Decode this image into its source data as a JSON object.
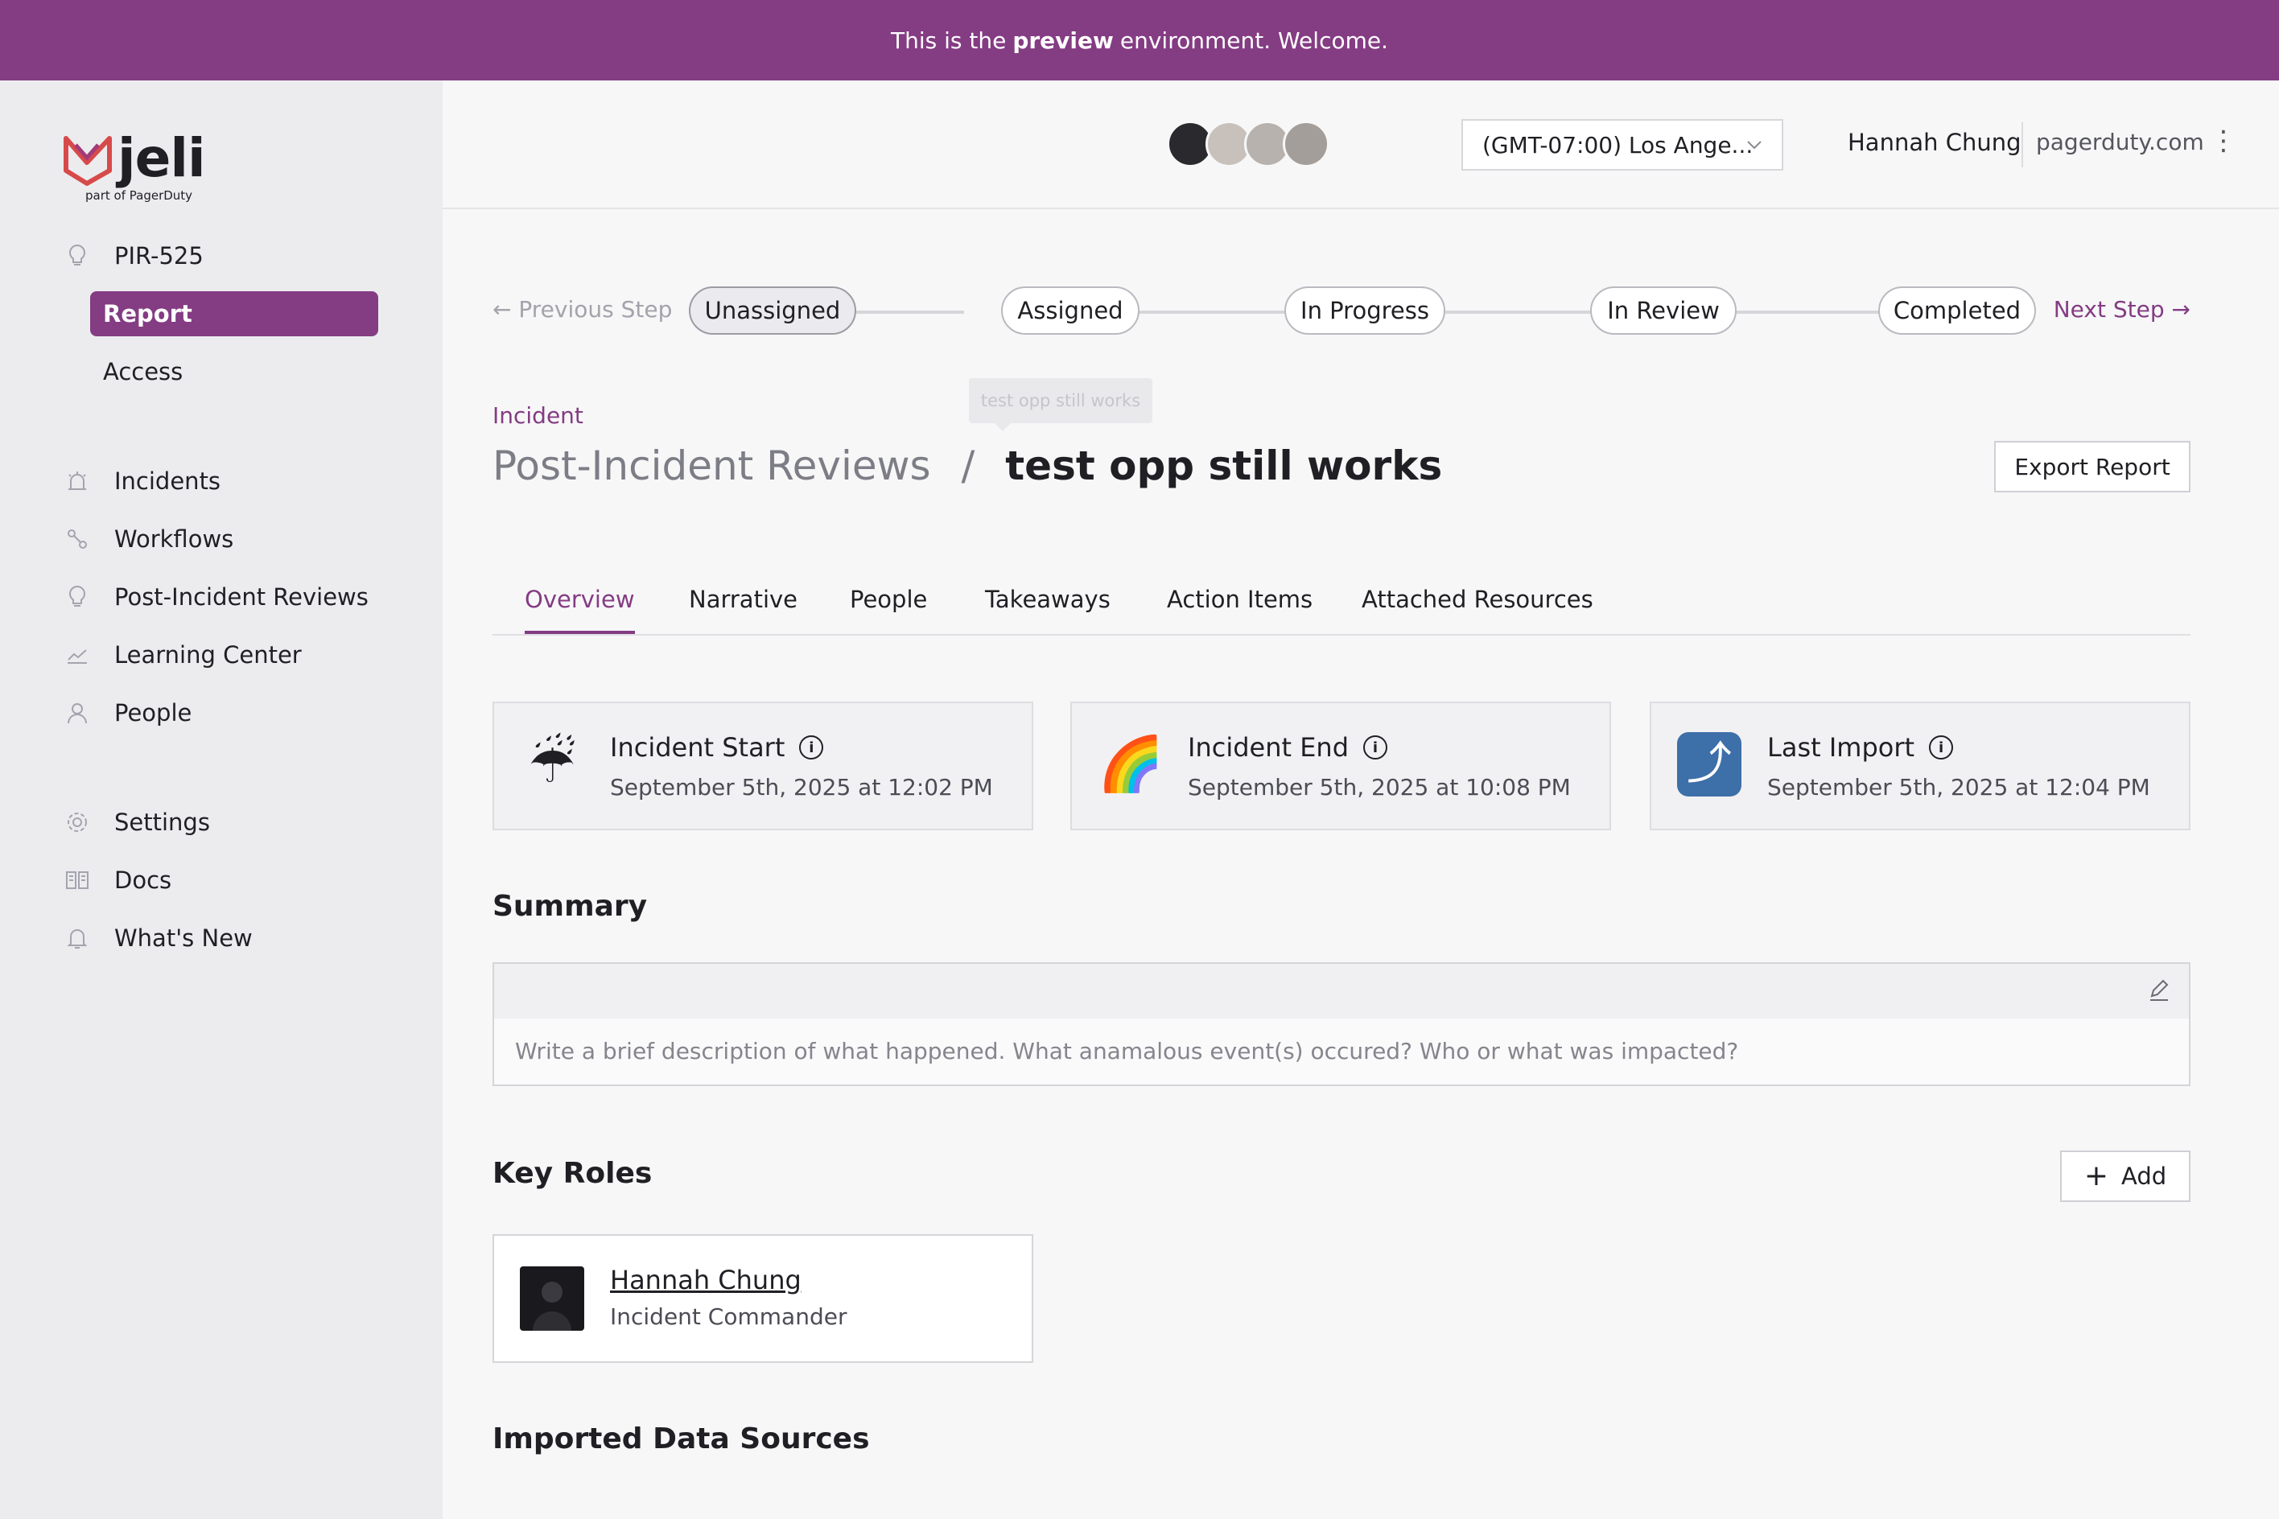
{
  "banner": {
    "prefix": "This is the",
    "bold": "preview",
    "suffix": "environment. Welcome."
  },
  "logo": {
    "name": "jeli",
    "sub": "part of PagerDuty"
  },
  "sidebar": {
    "pir_id": "PIR-525",
    "sub_items": [
      {
        "label": "Report",
        "active": true
      },
      {
        "label": "Access",
        "active": false
      }
    ],
    "main_items": [
      {
        "label": "Incidents",
        "icon": "siren-icon"
      },
      {
        "label": "Workflows",
        "icon": "workflow-icon"
      },
      {
        "label": "Post-Incident Reviews",
        "icon": "lightbulb-icon"
      },
      {
        "label": "Learning Center",
        "icon": "chart-line-icon"
      },
      {
        "label": "People",
        "icon": "person-icon"
      }
    ],
    "bottom_items": [
      {
        "label": "Settings",
        "icon": "gear-icon"
      },
      {
        "label": "Docs",
        "icon": "book-icon"
      },
      {
        "label": "What's New",
        "icon": "bell-icon"
      }
    ]
  },
  "topbar": {
    "timezone": "(GMT-07:00) Los Ange...",
    "user_name": "Hannah Chung",
    "user_org": "pagerduty.com"
  },
  "steps": {
    "prev_label": "Previous Step",
    "next_label": "Next Step",
    "items": [
      "Unassigned",
      "Assigned",
      "In Progress",
      "In Review",
      "Completed"
    ],
    "current": "Unassigned"
  },
  "tooltip": "test opp still works",
  "breadcrumb": "Incident",
  "title": {
    "parent": "Post-Incident Reviews",
    "separator": "/",
    "current": "test opp still works"
  },
  "export_label": "Export Report",
  "tabs": [
    {
      "label": "Overview",
      "active": true
    },
    {
      "label": "Narrative",
      "active": false
    },
    {
      "label": "People",
      "active": false
    },
    {
      "label": "Takeaways",
      "active": false
    },
    {
      "label": "Action Items",
      "active": false
    },
    {
      "label": "Attached Resources",
      "active": false
    }
  ],
  "cards": [
    {
      "title": "Incident Start",
      "date": "September 5th, 2025 at 12:02 PM",
      "emoji": "☔"
    },
    {
      "title": "Incident End",
      "date": "September 5th, 2025 at 10:08 PM",
      "emoji": "🌈"
    },
    {
      "title": "Last Import",
      "date": "September 5th, 2025 at 12:04 PM",
      "emoji": "⤴"
    }
  ],
  "summary": {
    "title": "Summary",
    "placeholder": "Write a brief description of what happened. What anamalous event(s) occured? Who or what was impacted?"
  },
  "key_roles": {
    "title": "Key Roles",
    "add_label": "Add",
    "people": [
      {
        "name": "Hannah Chung",
        "role": "Incident Commander"
      }
    ]
  },
  "imported_title": "Imported Data Sources",
  "colors": {
    "brand": "#843c83",
    "sidebar_bg": "#ececef",
    "page_bg": "#f7f7f8"
  }
}
